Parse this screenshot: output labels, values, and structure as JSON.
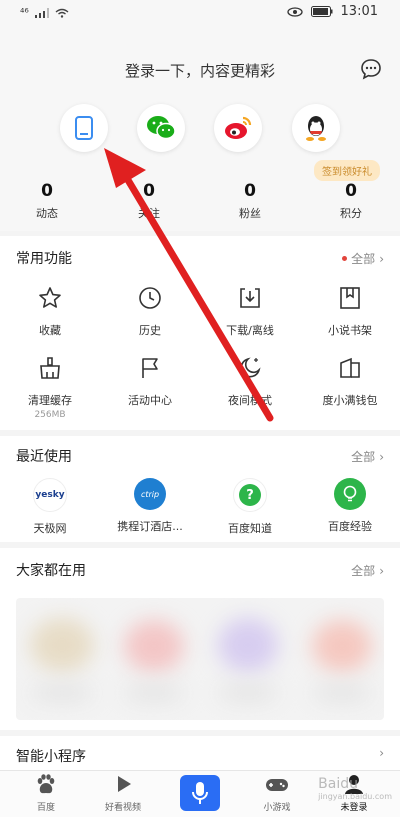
{
  "status_bar": {
    "signal": "⁴⁶",
    "time": "13:01"
  },
  "header": {
    "login_prompt": "登录一下，内容更精彩",
    "badge": "签到领好礼",
    "stats": [
      {
        "num": "0",
        "label": "动态"
      },
      {
        "num": "0",
        "label": "关注"
      },
      {
        "num": "0",
        "label": "粉丝"
      },
      {
        "num": "0",
        "label": "积分"
      }
    ]
  },
  "common": {
    "title": "常用功能",
    "more": "全部",
    "items": [
      {
        "label": "收藏",
        "icon": "star-icon"
      },
      {
        "label": "历史",
        "icon": "clock-icon"
      },
      {
        "label": "下载/离线",
        "icon": "download-icon"
      },
      {
        "label": "小说书架",
        "icon": "bookmark-icon"
      },
      {
        "label": "清理缓存",
        "sub": "256MB",
        "icon": "broom-icon"
      },
      {
        "label": "活动中心",
        "icon": "flag-icon"
      },
      {
        "label": "夜间模式",
        "icon": "moon-icon"
      },
      {
        "label": "度小满钱包",
        "icon": "wallet-icon"
      }
    ]
  },
  "recent": {
    "title": "最近使用",
    "more": "全部",
    "apps": [
      {
        "label": "天极网",
        "logo_text": "yesky"
      },
      {
        "label": "携程订酒店...",
        "logo_text": "ctrip"
      },
      {
        "label": "百度知道",
        "logo_text": "?"
      },
      {
        "label": "百度经验",
        "logo_text": ""
      }
    ]
  },
  "popular": {
    "title": "大家都在用",
    "more": "全部"
  },
  "mini": {
    "title": "智能小程序"
  },
  "tabs": [
    {
      "label": "百度"
    },
    {
      "label": "好看视频"
    },
    {
      "label": ""
    },
    {
      "label": "小游戏"
    },
    {
      "label": "未登录"
    }
  ],
  "watermark": {
    "text": "Baidu",
    "sub": "jingyan.baidu.com"
  },
  "colors": {
    "accent": "#2a6df4",
    "red": "#e2453c",
    "badge_bg": "#fde8c4"
  }
}
